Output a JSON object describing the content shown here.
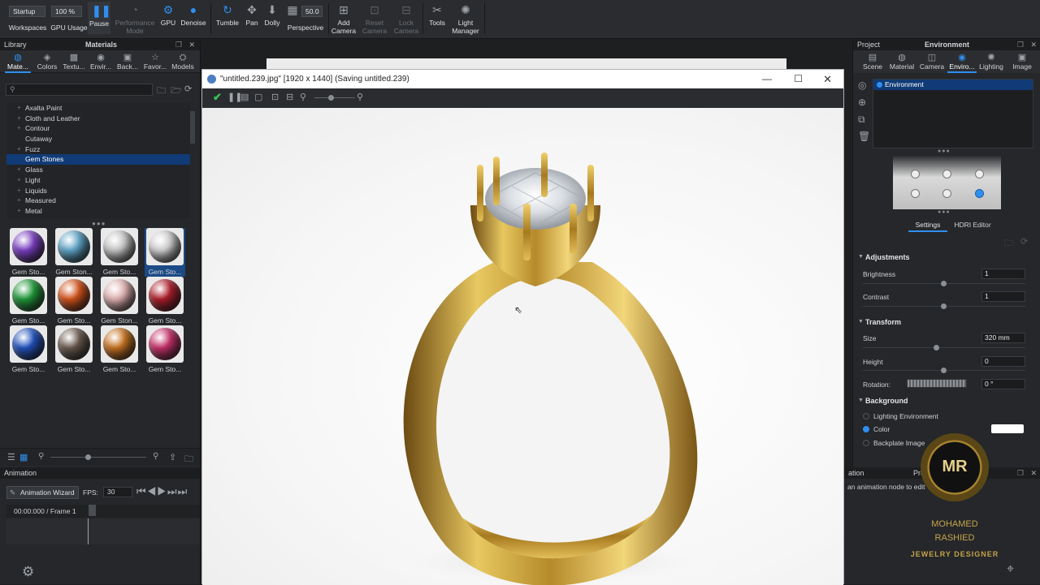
{
  "toolbar": {
    "workspace_value": "Startup",
    "workspaces_label": "Workspaces",
    "gpu_usage_value": "100 %",
    "gpu_usage_label": "GPU Usage",
    "pause_label": "Pause",
    "performance_label": "Performance Mode",
    "gpu_label": "GPU",
    "denoise_label": "Denoise",
    "tumble_label": "Tumble",
    "pan_label": "Pan",
    "dolly_label": "Dolly",
    "perspective_value": "50.0",
    "perspective_label": "Perspective",
    "add_camera_label": "Add Camera",
    "reset_camera_label": "Reset Camera",
    "lock_camera_label": "Lock Camera",
    "tools_label": "Tools",
    "light_manager_label": "Light Manager"
  },
  "library": {
    "header_left": "Library",
    "header_title": "Materials",
    "tabs": [
      "Mate...",
      "Colors",
      "Textu...",
      "Envir...",
      "Back...",
      "Favor...",
      "Models"
    ],
    "tree": [
      "Axalta Paint",
      "Cloth and Leather",
      "Contour",
      "Cutaway",
      "Fuzz",
      "Gem Stones",
      "Glass",
      "Light",
      "Liquids",
      "Measured",
      "Metal"
    ],
    "selected_tree": "Gem Stones",
    "thumbs": [
      {
        "label": "Gem Sto...",
        "color": "#7b3fc4"
      },
      {
        "label": "Gem Ston...",
        "color": "#5fa6c9"
      },
      {
        "label": "Gem Sto...",
        "color": "#c8c8c8"
      },
      {
        "label": "Gem Sto...",
        "color": "#d2d2d2"
      },
      {
        "label": "Gem Sto...",
        "color": "#1f9a3a"
      },
      {
        "label": "Gem Sto...",
        "color": "#d6531a"
      },
      {
        "label": "Gem Ston...",
        "color": "#e4b4b4"
      },
      {
        "label": "Gem Sto...",
        "color": "#b01d2a"
      },
      {
        "label": "Gem Sto...",
        "color": "#2052c0"
      },
      {
        "label": "Gem Sto...",
        "color": "#6a5a4e"
      },
      {
        "label": "Gem Sto...",
        "color": "#c9731f"
      },
      {
        "label": "Gem Sto...",
        "color": "#c8306a"
      }
    ]
  },
  "animation": {
    "header": "Animation",
    "wizard_label": "Animation Wizard",
    "fps_label": "FPS:",
    "fps_value": "30",
    "time_value": "00:00:000 / Frame 1"
  },
  "render_window": {
    "title": "\"untitled.239.jpg\" [1920 x 1440] (Saving untitled.239)"
  },
  "right_panel": {
    "header_left": "Project",
    "header_title": "Environment",
    "tabs": [
      "Scene",
      "Material",
      "Camera",
      "Enviro...",
      "Lighting",
      "Image"
    ],
    "env_item": "Environment",
    "subtabs": [
      "Settings",
      "HDRI Editor"
    ],
    "adjustments": "Adjustments",
    "brightness_label": "Brightness",
    "brightness_value": "1",
    "contrast_label": "Contrast",
    "contrast_value": "1",
    "transform": "Transform",
    "size_label": "Size",
    "size_value": "320 mm",
    "height_label": "Height",
    "height_value": "0",
    "rotation_label": "Rotation:",
    "rotation_value": "0 °",
    "background": "Background",
    "bg_options": [
      "Lighting Environment",
      "Color",
      "Backplate Image"
    ],
    "bg_selected": "Color"
  },
  "props_panel": {
    "header": "ation",
    "header2": "Prope",
    "hint": "an animation node to edit"
  },
  "watermark": {
    "initials": "MR",
    "line1": "MOHAMED",
    "line2": "RASHIED",
    "line3": "JEWELRY DESIGNER"
  },
  "colors": {
    "accent": "#2f8ff0",
    "selection": "#103b76",
    "gold": "#c5a44a"
  }
}
